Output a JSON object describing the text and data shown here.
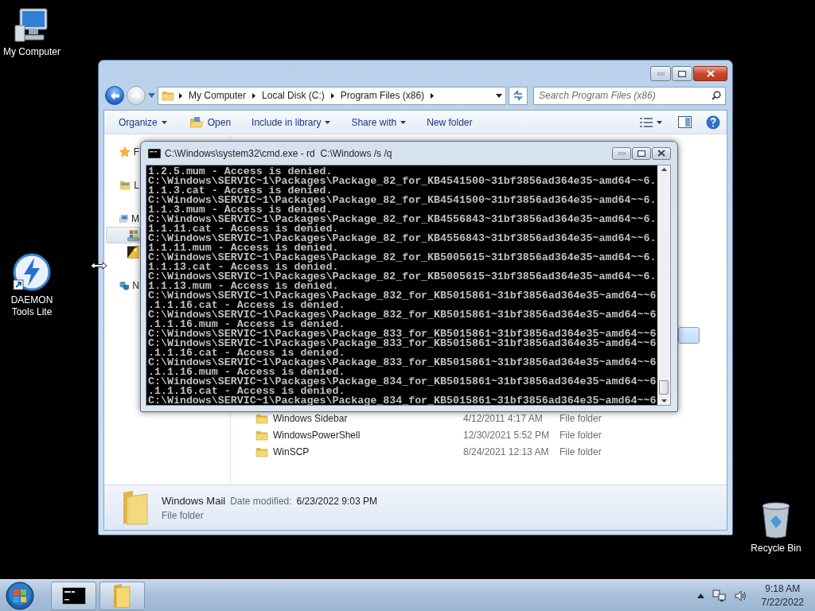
{
  "desktop_icons": [
    {
      "label": "My Computer",
      "kind": "computer"
    },
    {
      "label": "DAEMON Tools Lite",
      "kind": "daemon"
    },
    {
      "label": "Recycle Bin",
      "kind": "recycle"
    }
  ],
  "explorer": {
    "breadcrumbs": [
      "My Computer",
      "Local Disk (C:)",
      "Program Files (x86)"
    ],
    "search": {
      "placeholder": "Search Program Files (x86)"
    },
    "toolbar": [
      {
        "label": "Organize",
        "kind": "menu"
      },
      {
        "label": "Open",
        "kind": "open"
      },
      {
        "label": "Include in library",
        "kind": "menu"
      },
      {
        "label": "Share with",
        "kind": "menu"
      },
      {
        "label": "New folder",
        "kind": "plain"
      }
    ],
    "nav": [
      {
        "kind": "favorites",
        "label": "F",
        "selected": false
      },
      {
        "kind": "libraries",
        "label": "L",
        "selected": false
      },
      {
        "kind": "computer",
        "label": "M",
        "selected": false,
        "children": [
          {
            "kind": "drive",
            "selected": true
          },
          {
            "kind": "media",
            "selected": false
          }
        ]
      },
      {
        "kind": "network",
        "label": "N",
        "selected": false
      }
    ],
    "files": [
      {
        "selected": true
      },
      {
        "name": "Windows Sidebar",
        "date": "4/12/2011 4:17 AM",
        "type": "File folder",
        "selected": false
      },
      {
        "name": "WindowsPowerShell",
        "date": "12/30/2021 5:52 PM",
        "type": "File folder",
        "selected": false
      },
      {
        "name": "WinSCP",
        "date": "8/24/2021 12:13 AM",
        "type": "File folder",
        "selected": false
      }
    ],
    "details": {
      "name": "Windows Mail",
      "date_label": "Date modified:",
      "date": "6/23/2022 9:03 PM",
      "type": "File folder"
    }
  },
  "console": {
    "title": "C:\\Windows\\system32\\cmd.exe - rd  C:\\Windows /s /q",
    "lines": [
      "1.2.5.mum - Access is denied.",
      "C:\\Windows\\SERVIC~1\\Packages\\Package_82_for_KB4541500~31bf3856ad364e35~amd64~~6.",
      "1.1.3.cat - Access is denied.",
      "C:\\Windows\\SERVIC~1\\Packages\\Package_82_for_KB4541500~31bf3856ad364e35~amd64~~6.",
      "1.1.3.mum - Access is denied.",
      "C:\\Windows\\SERVIC~1\\Packages\\Package_82_for_KB4556843~31bf3856ad364e35~amd64~~6.",
      "1.1.11.cat - Access is denied.",
      "C:\\Windows\\SERVIC~1\\Packages\\Package_82_for_KB4556843~31bf3856ad364e35~amd64~~6.",
      "1.1.11.mum - Access is denied.",
      "C:\\Windows\\SERVIC~1\\Packages\\Package_82_for_KB5005615~31bf3856ad364e35~amd64~~6.",
      "1.1.13.cat - Access is denied.",
      "C:\\Windows\\SERVIC~1\\Packages\\Package_82_for_KB5005615~31bf3856ad364e35~amd64~~6.",
      "1.1.13.mum - Access is denied.",
      "C:\\Windows\\SERVIC~1\\Packages\\Package_832_for_KB5015861~31bf3856ad364e35~amd64~~6",
      ".1.1.16.cat - Access is denied.",
      "C:\\Windows\\SERVIC~1\\Packages\\Package_832_for_KB5015861~31bf3856ad364e35~amd64~~6",
      ".1.1.16.mum - Access is denied.",
      "C:\\Windows\\SERVIC~1\\Packages\\Package_833_for_KB5015861~31bf3856ad364e35~amd64~~6",
      "C:\\Windows\\SERVIC~1\\Packages\\Package_833_for_KB5015861~31bf3856ad364e35~amd64~~6",
      ".1.1.16.cat - Access is denied.",
      "C:\\Windows\\SERVIC~1\\Packages\\Package_833_for_KB5015861~31bf3856ad364e35~amd64~~6",
      ".1.1.16.mum - Access is denied.",
      "C:\\Windows\\SERVIC~1\\Packages\\Package_834_for_KB5015861~31bf3856ad364e35~amd64~~6",
      ".1.1.16.cat - Access is denied.",
      "C:\\Windows\\SERVIC~1\\Packages\\Package_834_for_KB5015861~31bf3856ad364e35~amd64~~6"
    ]
  },
  "taskbar": {
    "buttons": [
      {
        "kind": "console"
      },
      {
        "kind": "folder"
      }
    ],
    "clock": {
      "time": "9:18 AM",
      "date": "7/22/2022"
    }
  }
}
